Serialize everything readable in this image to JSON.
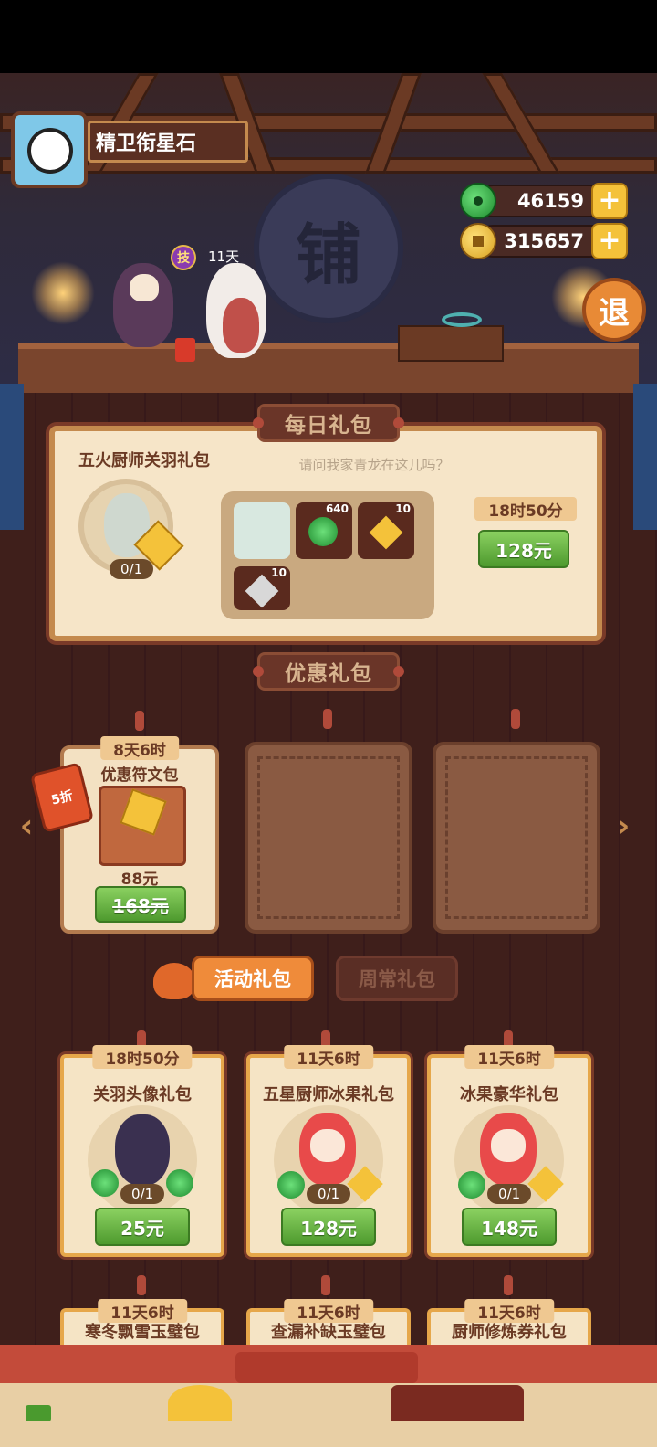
{
  "player": {
    "name": "精卫衔星石",
    "skill_badge": "技",
    "days": "11天"
  },
  "currency": {
    "jade": "46159",
    "coins": "315657",
    "plus": "+"
  },
  "shop_sign": "铺",
  "exit_label": "退",
  "daily": {
    "ribbon": "每日礼包",
    "title": "五火厨师关羽礼包",
    "quote": "请问我家青龙在这儿吗？",
    "count": "0/1",
    "items": [
      {
        "name": "chef-character",
        "qty": ""
      },
      {
        "name": "jade",
        "qty": "640"
      },
      {
        "name": "gold-rune",
        "qty": "10"
      },
      {
        "name": "silver-rune",
        "qty": "10"
      }
    ],
    "timer": "18时50分",
    "price": "128元"
  },
  "discount": {
    "ribbon": "优惠礼包",
    "card": {
      "timer": "8天6时",
      "title": "优惠符文包",
      "sale_price": "88元",
      "original_price": "168元",
      "tag": "5折"
    }
  },
  "tabs": {
    "active": "活动礼包",
    "inactive": "周常礼包"
  },
  "gift_cards": [
    {
      "timer": "18时50分",
      "title": "关羽头像礼包",
      "count": "0/1",
      "price": "25元"
    },
    {
      "timer": "11天6时",
      "title": "五星厨师冰果礼包",
      "count": "0/1",
      "price": "128元"
    },
    {
      "timer": "11天6时",
      "title": "冰果豪华礼包",
      "count": "0/1",
      "price": "148元"
    }
  ],
  "next_cards": [
    {
      "timer": "11天6时",
      "title": "寒冬飘雪玉璧包"
    },
    {
      "timer": "11天6时",
      "title": "查漏补缺玉璧包"
    },
    {
      "timer": "11天6时",
      "title": "厨师修炼券礼包"
    }
  ]
}
